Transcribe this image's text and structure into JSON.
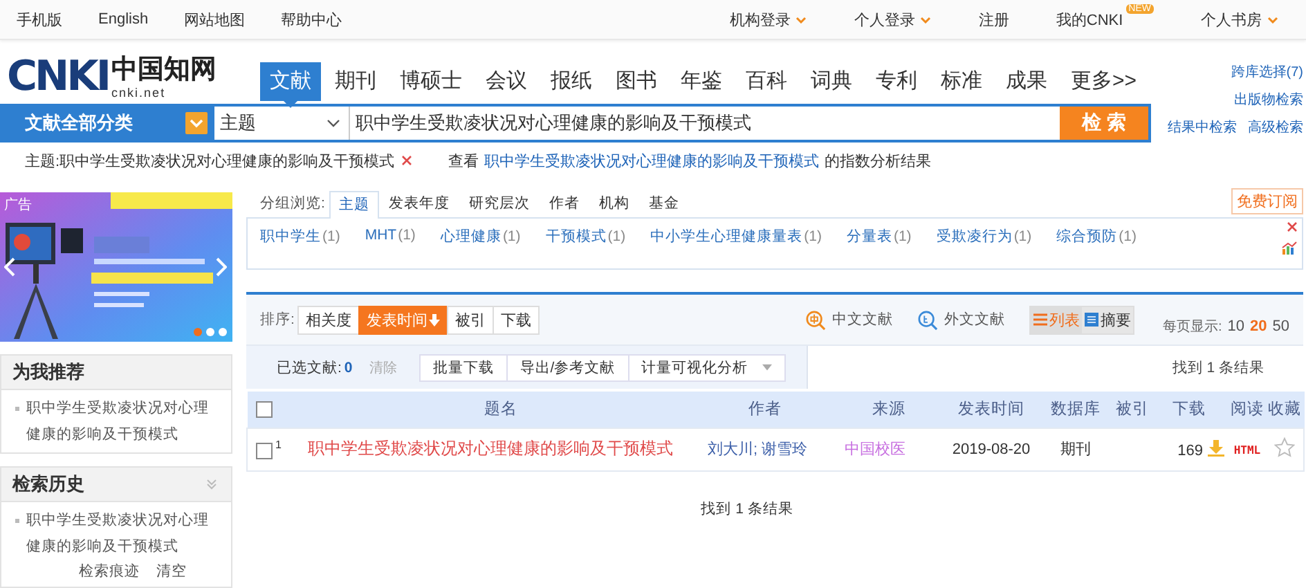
{
  "top_bar": {
    "left_links": [
      "手机版",
      "English",
      "网站地图",
      "帮助中心"
    ],
    "right_links": [
      {
        "label": "机构登录",
        "dropdown": true
      },
      {
        "label": "个人登录",
        "dropdown": true
      },
      {
        "label": "注册",
        "dropdown": false
      },
      {
        "label": "我的CNKI",
        "dropdown": false,
        "badge": "NEW"
      },
      {
        "label": "个人书房",
        "dropdown": true
      }
    ]
  },
  "logo": {
    "mark": "CNKI",
    "chinese": "中国知网",
    "domain": "cnki.net"
  },
  "nav_tabs": [
    {
      "label": "文献",
      "selected": true
    },
    {
      "label": "期刊",
      "selected": false
    },
    {
      "label": "博硕士",
      "selected": false
    },
    {
      "label": "会议",
      "selected": false
    },
    {
      "label": "报纸",
      "selected": false
    },
    {
      "label": "图书",
      "selected": false
    },
    {
      "label": "年鉴",
      "selected": false
    },
    {
      "label": "百科",
      "selected": false
    },
    {
      "label": "词典",
      "selected": false
    },
    {
      "label": "专利",
      "selected": false
    },
    {
      "label": "标准",
      "selected": false
    },
    {
      "label": "成果",
      "selected": false
    },
    {
      "label": "更多>>",
      "selected": false
    }
  ],
  "side_links": [
    "跨库选择(7)",
    "出版物检索",
    "结果中检索",
    "高级检索"
  ],
  "search": {
    "category": "文献全部分类",
    "field": "主题",
    "value": "职中学生受欺凌状况对心理健康的影响及干预模式",
    "button": "检 索"
  },
  "query_line": {
    "condition_label": "主题:",
    "condition_value": "职中学生受欺凌状况对心理健康的影响及干预模式",
    "view_prefix": "查看",
    "view_link": "职中学生受欺凌状况对心理健康的影响及干预模式",
    "view_suffix": "的指数分析结果"
  },
  "ad": {
    "label": "广告",
    "dots": [
      {
        "selected": true
      },
      {
        "selected": false
      },
      {
        "selected": false
      }
    ]
  },
  "recommend": {
    "title": "为我推荐",
    "items": [
      "职中学生受欺凌状况对心理健康的影响及干预模式"
    ]
  },
  "history": {
    "title": "检索历史",
    "items": [
      "职中学生受欺凌状况对心理健康的影响及干预模式"
    ],
    "links": [
      "检索痕迹",
      "清空"
    ]
  },
  "group_browse": {
    "label": "分组浏览:",
    "subscribe": "免费订阅",
    "tabs": [
      {
        "label": "主题",
        "selected": true
      },
      {
        "label": "发表年度",
        "selected": false
      },
      {
        "label": "研究层次",
        "selected": false
      },
      {
        "label": "作者",
        "selected": false
      },
      {
        "label": "机构",
        "selected": false
      },
      {
        "label": "基金",
        "selected": false
      }
    ],
    "tags": [
      {
        "name": "职中学生",
        "count": "(1)"
      },
      {
        "name": "MHT",
        "count": "(1)"
      },
      {
        "name": "心理健康",
        "count": "(1)"
      },
      {
        "name": "干预模式",
        "count": "(1)"
      },
      {
        "name": "中小学生心理健康量表",
        "count": "(1)"
      },
      {
        "name": "分量表",
        "count": "(1)"
      },
      {
        "name": "受欺凌行为",
        "count": "(1)"
      },
      {
        "name": "综合预防",
        "count": "(1)"
      }
    ]
  },
  "sort": {
    "label": "排序:",
    "options": [
      {
        "label": "相关度",
        "selected": false
      },
      {
        "label": "发表时间",
        "selected": true
      },
      {
        "label": "被引",
        "selected": false
      },
      {
        "label": "下载",
        "selected": false
      }
    ],
    "lang_filters": [
      {
        "kind": "zh",
        "label": "中文文献"
      },
      {
        "kind": "en",
        "label": "外文文献"
      }
    ],
    "views": [
      {
        "kind": "list",
        "label": "列表",
        "selected": true
      },
      {
        "kind": "abstract",
        "label": "摘要",
        "selected": false
      }
    ],
    "page_size_label": "每页显示:",
    "page_sizes": [
      {
        "label": "10",
        "selected": false
      },
      {
        "label": "20",
        "selected": true
      },
      {
        "label": "50",
        "selected": false
      }
    ]
  },
  "toolbar": {
    "selected_label": "已选文献:",
    "selected_count": "0",
    "clear": "清除",
    "buttons": [
      "批量下载",
      "导出/参考文献",
      "计量可视化分析"
    ],
    "found": "找到 1 条结果"
  },
  "table": {
    "header_checked": false,
    "columns": [
      "题名",
      "作者",
      "来源",
      "发表时间",
      "数据库",
      "被引",
      "下载",
      "阅读",
      "收藏"
    ],
    "rows": [
      {
        "index": "1",
        "checked": false,
        "title": "职中学生受欺凌状况对心理健康的影响及干预模式",
        "authors": "刘大川; 谢雪玲",
        "source": "中国校医",
        "date": "2019-08-20",
        "database": "期刊",
        "downloads": "169",
        "read": "HTML",
        "favorite": false
      }
    ]
  },
  "footer_count": "找到 1 条结果"
}
